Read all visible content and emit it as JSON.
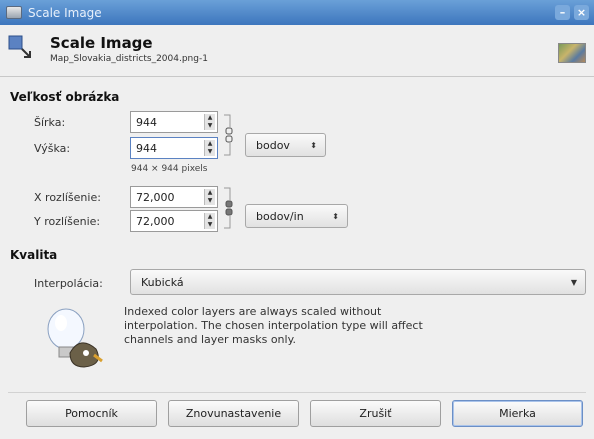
{
  "window": {
    "title": "Scale Image"
  },
  "header": {
    "title": "Scale Image",
    "subtitle": "Map_Slovakia_districts_2004.png-1"
  },
  "size_section": {
    "title": "Veľkosť obrázka",
    "width": {
      "label": "Šírka:",
      "value": "944"
    },
    "height": {
      "label": "Výška:",
      "value": "944"
    },
    "unit": "bodov",
    "pixel_info": "944 × 944 pixels",
    "x_res": {
      "label": "X rozlíšenie:",
      "value": "72,000"
    },
    "y_res": {
      "label": "Y rozlíšenie:",
      "value": "72,000"
    },
    "res_unit": "bodov/in"
  },
  "quality_section": {
    "title": "Kvalita",
    "interp_label": "Interpolácia:",
    "interp_value": "Kubická",
    "note": "Indexed color layers are always scaled without interpolation. The chosen interpolation type will affect channels and layer masks only."
  },
  "buttons": {
    "help": "Pomocník",
    "reset": "Znovunastavenie",
    "cancel": "Zrušiť",
    "scale": "Mierka"
  },
  "colors": {
    "titlebar": "#4a83c8",
    "accent": "#6b8fc6"
  }
}
